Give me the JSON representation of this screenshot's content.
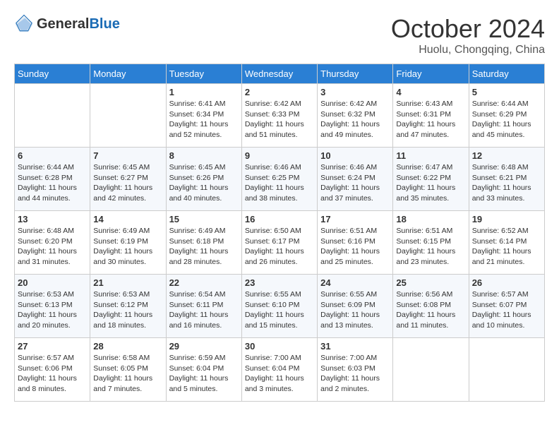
{
  "header": {
    "logo_general": "General",
    "logo_blue": "Blue",
    "month": "October 2024",
    "location": "Huolu, Chongqing, China"
  },
  "weekdays": [
    "Sunday",
    "Monday",
    "Tuesday",
    "Wednesday",
    "Thursday",
    "Friday",
    "Saturday"
  ],
  "weeks": [
    [
      {
        "day": "",
        "empty": true
      },
      {
        "day": "",
        "empty": true
      },
      {
        "day": "1",
        "sunrise": "Sunrise: 6:41 AM",
        "sunset": "Sunset: 6:34 PM",
        "daylight": "Daylight: 11 hours and 52 minutes."
      },
      {
        "day": "2",
        "sunrise": "Sunrise: 6:42 AM",
        "sunset": "Sunset: 6:33 PM",
        "daylight": "Daylight: 11 hours and 51 minutes."
      },
      {
        "day": "3",
        "sunrise": "Sunrise: 6:42 AM",
        "sunset": "Sunset: 6:32 PM",
        "daylight": "Daylight: 11 hours and 49 minutes."
      },
      {
        "day": "4",
        "sunrise": "Sunrise: 6:43 AM",
        "sunset": "Sunset: 6:31 PM",
        "daylight": "Daylight: 11 hours and 47 minutes."
      },
      {
        "day": "5",
        "sunrise": "Sunrise: 6:44 AM",
        "sunset": "Sunset: 6:29 PM",
        "daylight": "Daylight: 11 hours and 45 minutes."
      }
    ],
    [
      {
        "day": "6",
        "sunrise": "Sunrise: 6:44 AM",
        "sunset": "Sunset: 6:28 PM",
        "daylight": "Daylight: 11 hours and 44 minutes."
      },
      {
        "day": "7",
        "sunrise": "Sunrise: 6:45 AM",
        "sunset": "Sunset: 6:27 PM",
        "daylight": "Daylight: 11 hours and 42 minutes."
      },
      {
        "day": "8",
        "sunrise": "Sunrise: 6:45 AM",
        "sunset": "Sunset: 6:26 PM",
        "daylight": "Daylight: 11 hours and 40 minutes."
      },
      {
        "day": "9",
        "sunrise": "Sunrise: 6:46 AM",
        "sunset": "Sunset: 6:25 PM",
        "daylight": "Daylight: 11 hours and 38 minutes."
      },
      {
        "day": "10",
        "sunrise": "Sunrise: 6:46 AM",
        "sunset": "Sunset: 6:24 PM",
        "daylight": "Daylight: 11 hours and 37 minutes."
      },
      {
        "day": "11",
        "sunrise": "Sunrise: 6:47 AM",
        "sunset": "Sunset: 6:22 PM",
        "daylight": "Daylight: 11 hours and 35 minutes."
      },
      {
        "day": "12",
        "sunrise": "Sunrise: 6:48 AM",
        "sunset": "Sunset: 6:21 PM",
        "daylight": "Daylight: 11 hours and 33 minutes."
      }
    ],
    [
      {
        "day": "13",
        "sunrise": "Sunrise: 6:48 AM",
        "sunset": "Sunset: 6:20 PM",
        "daylight": "Daylight: 11 hours and 31 minutes."
      },
      {
        "day": "14",
        "sunrise": "Sunrise: 6:49 AM",
        "sunset": "Sunset: 6:19 PM",
        "daylight": "Daylight: 11 hours and 30 minutes."
      },
      {
        "day": "15",
        "sunrise": "Sunrise: 6:49 AM",
        "sunset": "Sunset: 6:18 PM",
        "daylight": "Daylight: 11 hours and 28 minutes."
      },
      {
        "day": "16",
        "sunrise": "Sunrise: 6:50 AM",
        "sunset": "Sunset: 6:17 PM",
        "daylight": "Daylight: 11 hours and 26 minutes."
      },
      {
        "day": "17",
        "sunrise": "Sunrise: 6:51 AM",
        "sunset": "Sunset: 6:16 PM",
        "daylight": "Daylight: 11 hours and 25 minutes."
      },
      {
        "day": "18",
        "sunrise": "Sunrise: 6:51 AM",
        "sunset": "Sunset: 6:15 PM",
        "daylight": "Daylight: 11 hours and 23 minutes."
      },
      {
        "day": "19",
        "sunrise": "Sunrise: 6:52 AM",
        "sunset": "Sunset: 6:14 PM",
        "daylight": "Daylight: 11 hours and 21 minutes."
      }
    ],
    [
      {
        "day": "20",
        "sunrise": "Sunrise: 6:53 AM",
        "sunset": "Sunset: 6:13 PM",
        "daylight": "Daylight: 11 hours and 20 minutes."
      },
      {
        "day": "21",
        "sunrise": "Sunrise: 6:53 AM",
        "sunset": "Sunset: 6:12 PM",
        "daylight": "Daylight: 11 hours and 18 minutes."
      },
      {
        "day": "22",
        "sunrise": "Sunrise: 6:54 AM",
        "sunset": "Sunset: 6:11 PM",
        "daylight": "Daylight: 11 hours and 16 minutes."
      },
      {
        "day": "23",
        "sunrise": "Sunrise: 6:55 AM",
        "sunset": "Sunset: 6:10 PM",
        "daylight": "Daylight: 11 hours and 15 minutes."
      },
      {
        "day": "24",
        "sunrise": "Sunrise: 6:55 AM",
        "sunset": "Sunset: 6:09 PM",
        "daylight": "Daylight: 11 hours and 13 minutes."
      },
      {
        "day": "25",
        "sunrise": "Sunrise: 6:56 AM",
        "sunset": "Sunset: 6:08 PM",
        "daylight": "Daylight: 11 hours and 11 minutes."
      },
      {
        "day": "26",
        "sunrise": "Sunrise: 6:57 AM",
        "sunset": "Sunset: 6:07 PM",
        "daylight": "Daylight: 11 hours and 10 minutes."
      }
    ],
    [
      {
        "day": "27",
        "sunrise": "Sunrise: 6:57 AM",
        "sunset": "Sunset: 6:06 PM",
        "daylight": "Daylight: 11 hours and 8 minutes."
      },
      {
        "day": "28",
        "sunrise": "Sunrise: 6:58 AM",
        "sunset": "Sunset: 6:05 PM",
        "daylight": "Daylight: 11 hours and 7 minutes."
      },
      {
        "day": "29",
        "sunrise": "Sunrise: 6:59 AM",
        "sunset": "Sunset: 6:04 PM",
        "daylight": "Daylight: 11 hours and 5 minutes."
      },
      {
        "day": "30",
        "sunrise": "Sunrise: 7:00 AM",
        "sunset": "Sunset: 6:04 PM",
        "daylight": "Daylight: 11 hours and 3 minutes."
      },
      {
        "day": "31",
        "sunrise": "Sunrise: 7:00 AM",
        "sunset": "Sunset: 6:03 PM",
        "daylight": "Daylight: 11 hours and 2 minutes."
      },
      {
        "day": "",
        "empty": true
      },
      {
        "day": "",
        "empty": true
      }
    ]
  ]
}
